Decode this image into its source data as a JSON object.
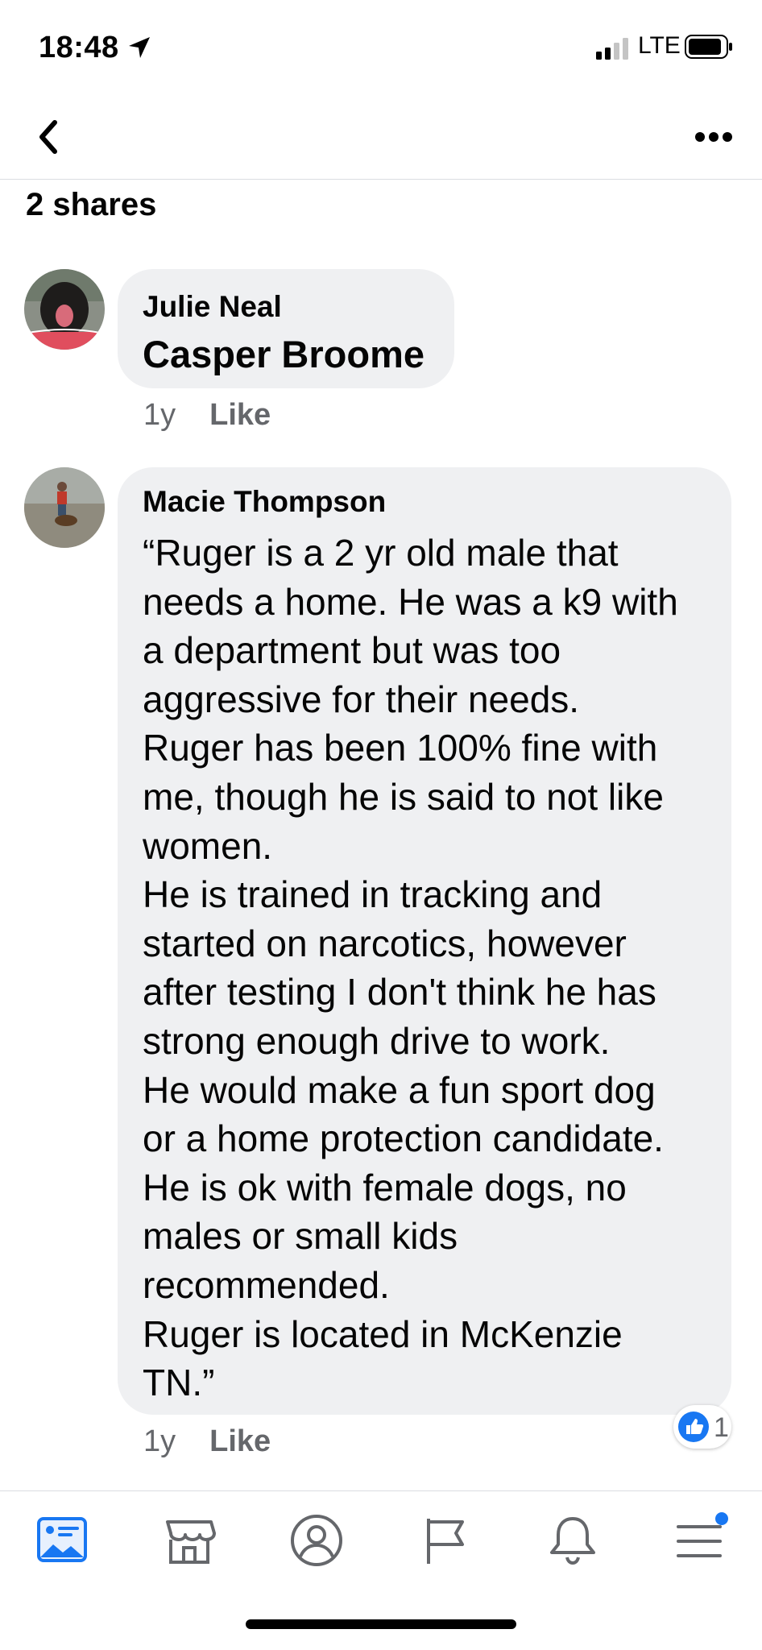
{
  "status": {
    "time": "18:48",
    "network": "LTE",
    "icons": [
      "location-arrow-icon",
      "signal-icon",
      "battery-icon"
    ]
  },
  "nav": {
    "icons": [
      "back-chevron-icon",
      "more-dots-icon"
    ]
  },
  "shares_label": "2 shares",
  "comments": [
    {
      "author": "Julie Neal",
      "mention": "Casper Broome",
      "time": "1y",
      "like": "Like"
    },
    {
      "author": "Macie Thompson",
      "text": "“Ruger is a 2 yr old male that\nneeds a home. He was a k9 with\na department but was too\naggressive for their needs.\nRuger has been 100% fine with\nme, though he is said to not like\nwomen.\nHe is trained in tracking and\nstarted on narcotics, however\nafter testing I don't think he has\nstrong enough drive to work.\nHe would make a fun sport dog\nor a home protection candidate.\nHe is ok with female dogs, no\nmales or small kids\nrecommended.\nRuger is located in McKenzie\nTN.”",
      "time": "1y",
      "like": "Like",
      "reaction_count": "1"
    }
  ],
  "tabbar": {
    "tabs": [
      "news-feed-icon",
      "marketplace-icon",
      "profile-icon",
      "pages-flag-icon",
      "notifications-bell-icon",
      "menu-icon"
    ]
  },
  "colors": {
    "bubble": "#eff0f2",
    "meta_text": "#65676b",
    "active_tab": "#1877f2",
    "like_blue": "#1877f2"
  }
}
